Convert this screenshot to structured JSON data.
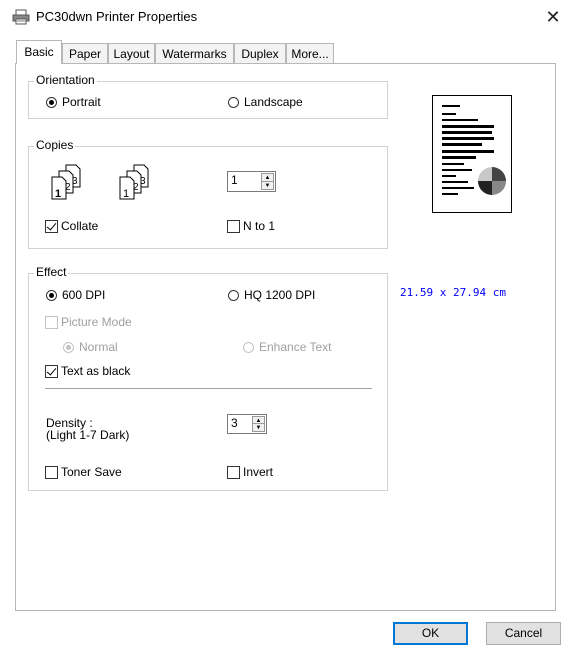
{
  "window": {
    "title": "PC30dwn Printer Properties",
    "close_glyph": "✕"
  },
  "tabs": [
    {
      "label": "Basic",
      "active": true
    },
    {
      "label": "Paper"
    },
    {
      "label": "Layout"
    },
    {
      "label": "Watermarks"
    },
    {
      "label": "Duplex"
    },
    {
      "label": "More..."
    }
  ],
  "orientation": {
    "legend": "Orientation",
    "portrait": {
      "label": "Portrait",
      "selected": true
    },
    "landscape": {
      "label": "Landscape",
      "selected": false
    }
  },
  "copies": {
    "legend": "Copies",
    "count": "1",
    "collate": {
      "label": "Collate",
      "checked": true
    },
    "n_to_1": {
      "label": "N to 1",
      "checked": false
    },
    "page_numbers_collated": [
      "1",
      "2",
      "3"
    ],
    "page_numbers_uncollated": [
      "1",
      "2",
      "3"
    ]
  },
  "effect": {
    "legend": "Effect",
    "dpi_600": {
      "label": "600 DPI",
      "selected": true
    },
    "dpi_hq1200": {
      "label": "HQ 1200 DPI",
      "selected": false
    },
    "picture_mode": {
      "label": "Picture Mode",
      "checked": false,
      "disabled": true
    },
    "normal": {
      "label": "Normal",
      "selected": true,
      "disabled": true
    },
    "enhance_text": {
      "label": "Enhance Text",
      "selected": false,
      "disabled": true
    },
    "text_as_black": {
      "label": "Text as black",
      "checked": true
    },
    "density_label": "Density :",
    "density_range": "(Light 1-7 Dark)",
    "density_value": "3",
    "toner_save": {
      "label": "Toner Save",
      "checked": false
    },
    "invert": {
      "label": "Invert",
      "checked": false
    }
  },
  "preview": {
    "paper_size": "21.59 x 27.94 cm"
  },
  "buttons": {
    "ok": "OK",
    "cancel": "Cancel"
  },
  "colors": {
    "accent": "#0078d7",
    "paper_size_text": "#0000ff"
  }
}
